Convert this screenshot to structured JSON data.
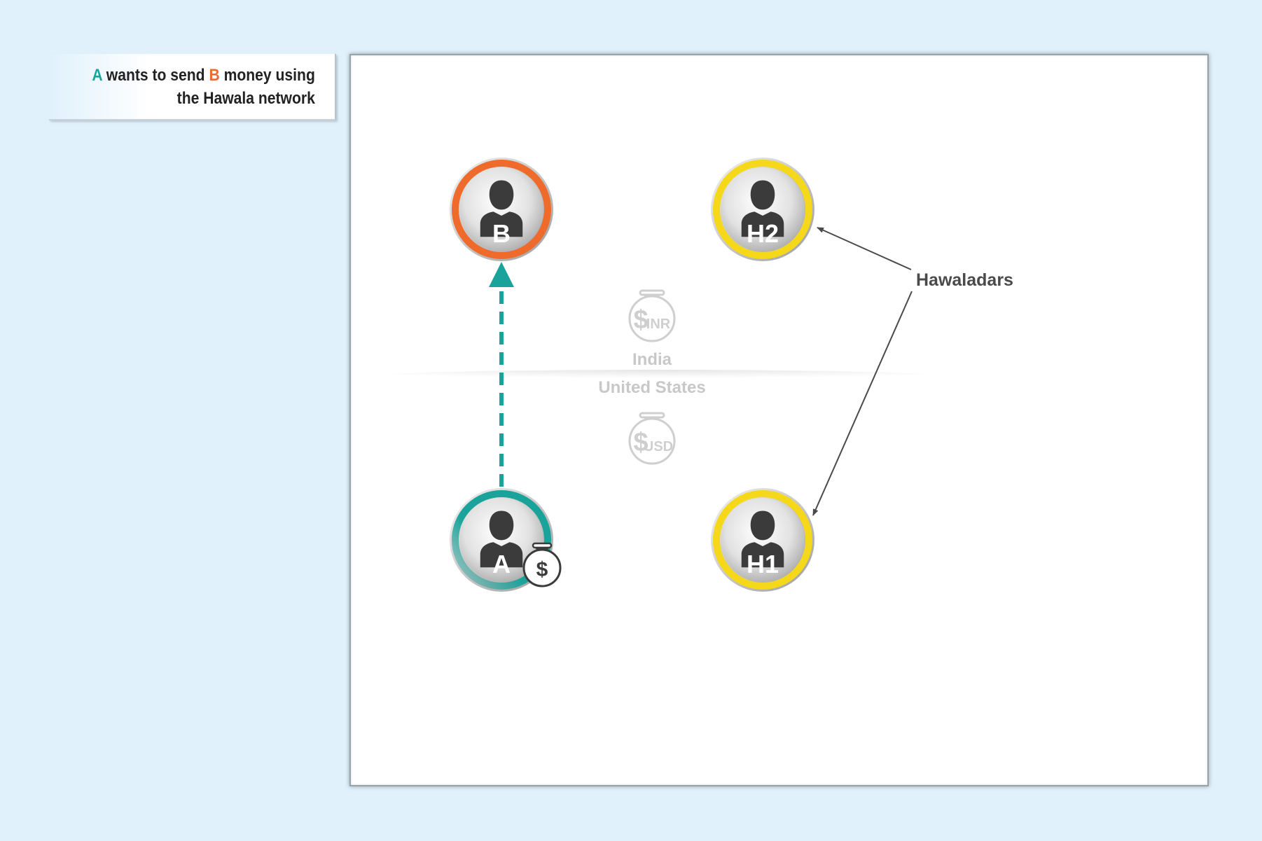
{
  "caption": {
    "a": "A",
    "text1": " wants to send ",
    "b": "B",
    "text2": " money using",
    "line2": "the Hawala network"
  },
  "colors": {
    "teal": "#1aa39a",
    "orange": "#ee6b2b",
    "yellow": "#f5d81a",
    "muted": "#c8c8c8",
    "dark": "#3b3b3b"
  },
  "nodes": {
    "b": {
      "label": "B",
      "ring": "orange"
    },
    "h2": {
      "label": "H2",
      "ring": "yellow"
    },
    "a": {
      "label": "A",
      "ring": "teal"
    },
    "h1": {
      "label": "H1",
      "ring": "yellow"
    }
  },
  "bags": {
    "inr": {
      "symbol": "$",
      "currency": "INR"
    },
    "usd": {
      "symbol": "$",
      "currency": "USD"
    },
    "a_bag": {
      "symbol": "$"
    }
  },
  "regions": {
    "top": "India",
    "bottom": "United States"
  },
  "annotation": {
    "label": "Hawaladars"
  }
}
